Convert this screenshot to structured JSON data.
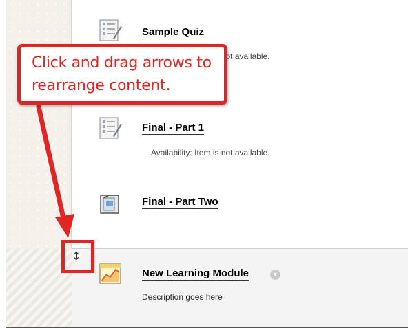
{
  "callout": {
    "line1": "Click and drag arrows to",
    "line2": "rearrange content."
  },
  "items": [
    {
      "title": "Sample Quiz",
      "note": "Availability:  Item is not available.",
      "icon": "test-icon"
    },
    {
      "title": "Final - Part 1",
      "note": "Availability:  Item is not available.",
      "icon": "test-icon"
    },
    {
      "title": "Final - Part Two",
      "icon": "folder-icon"
    },
    {
      "title": "New Learning Module",
      "description": "Description goes here",
      "icon": "learning-module-icon"
    }
  ],
  "drag_handle": {
    "glyph": "↕",
    "icon": "drag-arrows-icon"
  },
  "colors": {
    "accent": "#e12424"
  }
}
